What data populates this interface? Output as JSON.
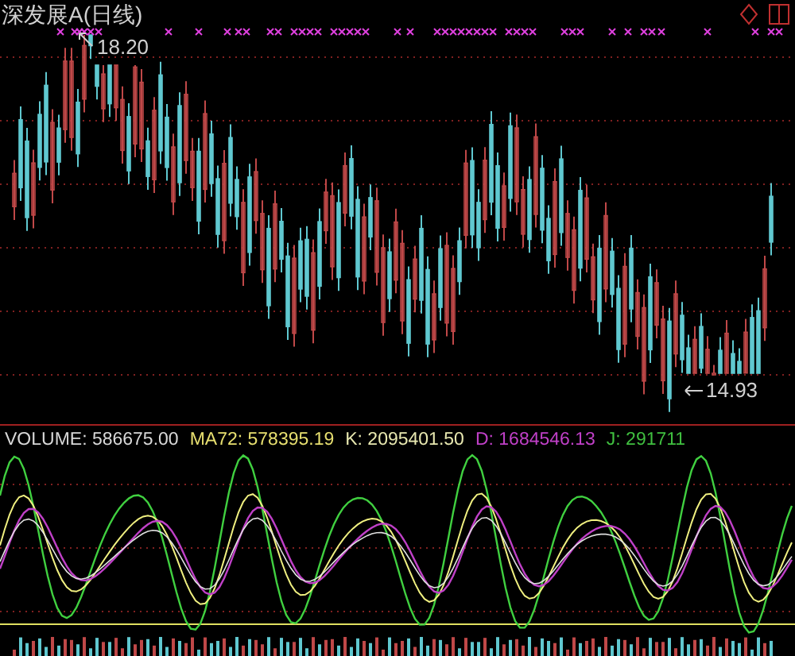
{
  "chart_title": "深发展A(日线)",
  "high_marker": {
    "label": "18.20"
  },
  "low_marker": {
    "label": "14.93"
  },
  "indicator_readouts": [
    {
      "text": "VOLUME: 586675.00",
      "color": "#d8d8d8"
    },
    {
      "text": "MA72: 578395.19",
      "color": "#e8e070"
    },
    {
      "text": "K: 2095401.50",
      "color": "#e8e8b0"
    },
    {
      "text": "D: 1684546.13",
      "color": "#c040c8"
    },
    {
      "text": "J: 291711",
      "color": "#40c040"
    }
  ]
}
